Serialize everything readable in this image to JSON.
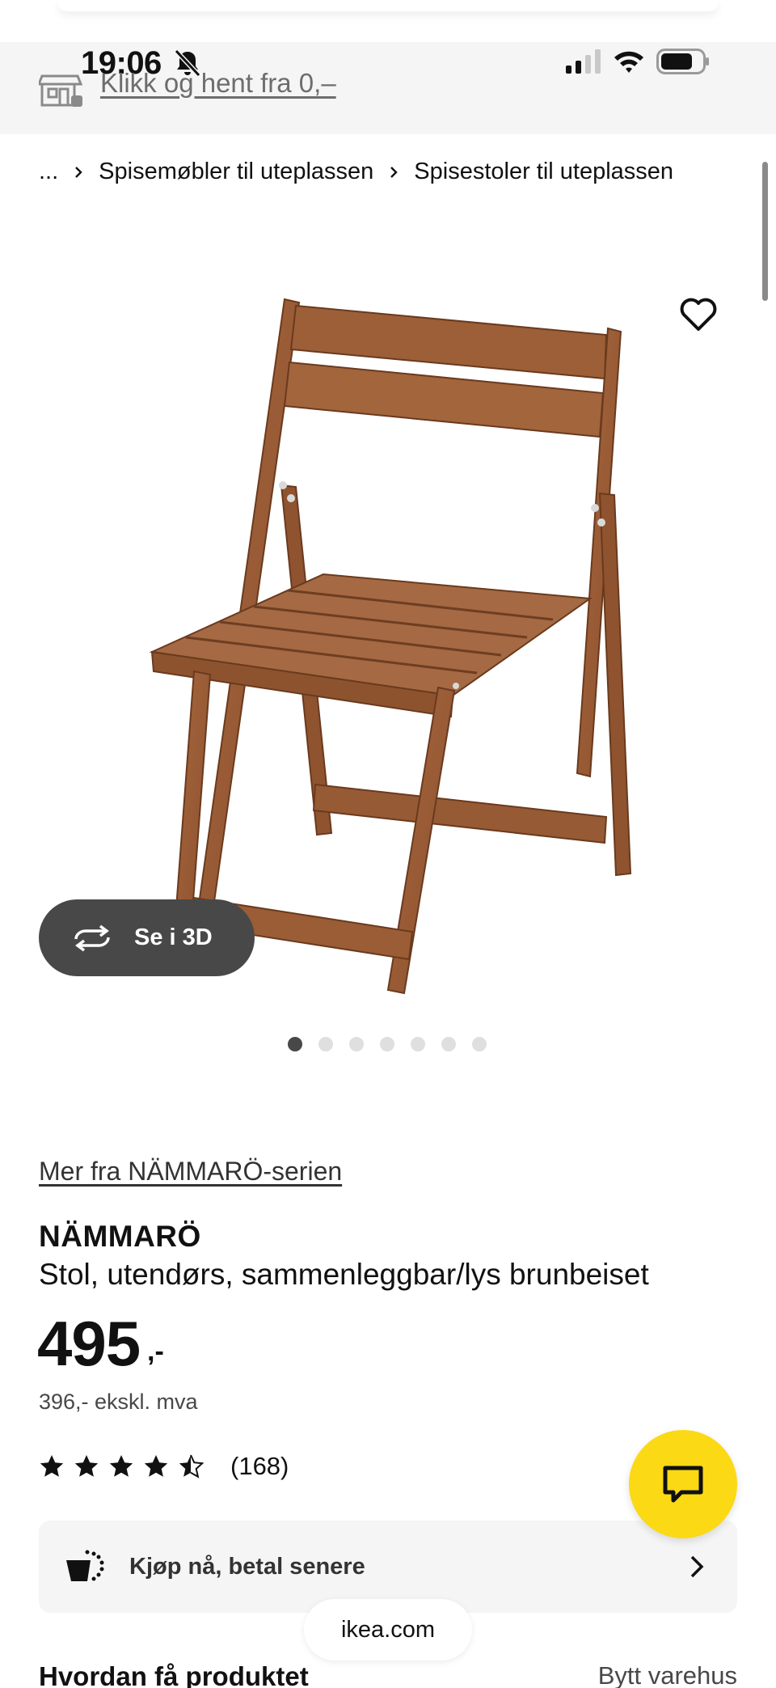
{
  "status_bar": {
    "time": "19:06",
    "icons": [
      "bell-slash-icon",
      "signal-icon",
      "wifi-icon",
      "battery-icon"
    ]
  },
  "header": {
    "pickup_text": "Klikk og hent fra 0,–",
    "icon": "store-icon"
  },
  "breadcrumb": {
    "items": [
      "...",
      "Spisemøbler til uteplassen",
      "Spisestoler til uteplassen"
    ]
  },
  "gallery": {
    "button_3d": "Se i 3D",
    "dot_count": 7,
    "active_dot": 0,
    "favorite_icon": "heart-icon"
  },
  "product": {
    "series_link": "Mer fra NÄMMARÖ-serien",
    "name": "NÄMMARÖ",
    "description": "Stol, utendørs, sammenleggbar/lys brunbeiset",
    "price": "495",
    "price_suffix": ",-",
    "price_excl": "396,- ekskl. mva",
    "rating": 4.5,
    "rating_count": "(168)"
  },
  "paylater": {
    "label": "Kjøp nå, betal senere"
  },
  "browser": {
    "url": "ikea.com"
  },
  "delivery": {
    "title": "Hvordan få produktet",
    "change_store": "Bytt varehus"
  },
  "colors": {
    "accent_yellow": "#fbd914",
    "dark_gray": "#484848",
    "wood": "#9b5e3a"
  }
}
